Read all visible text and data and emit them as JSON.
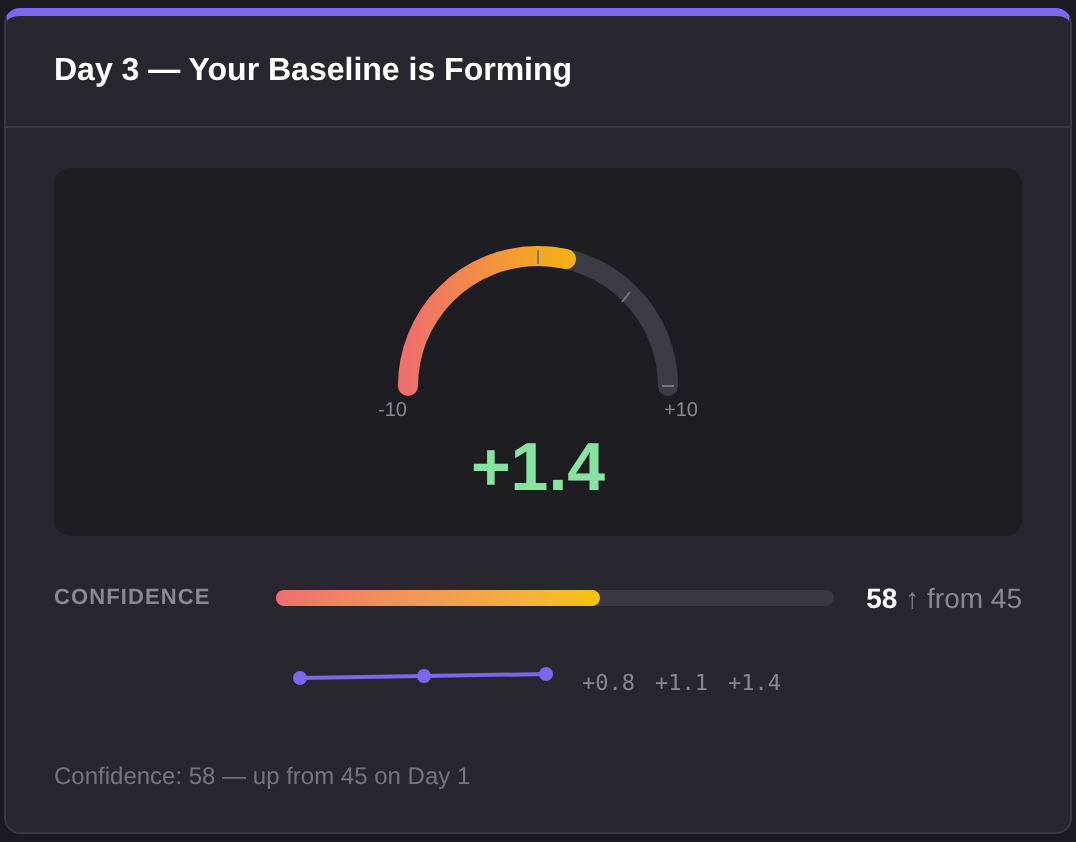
{
  "card": {
    "title": "Day 3 — Your Baseline is Forming"
  },
  "gauge": {
    "min_label": "-10",
    "max_label": "+10",
    "value": "+1.4"
  },
  "confidence": {
    "label": "CONFIDENCE",
    "level": 0.58,
    "value": "58",
    "change": "↑ from 45"
  },
  "trend": {
    "labels": [
      "+0.8",
      "+1.1",
      "+1.4"
    ]
  },
  "footnote": "Confidence: 58 — up from 45 on Day 1"
}
